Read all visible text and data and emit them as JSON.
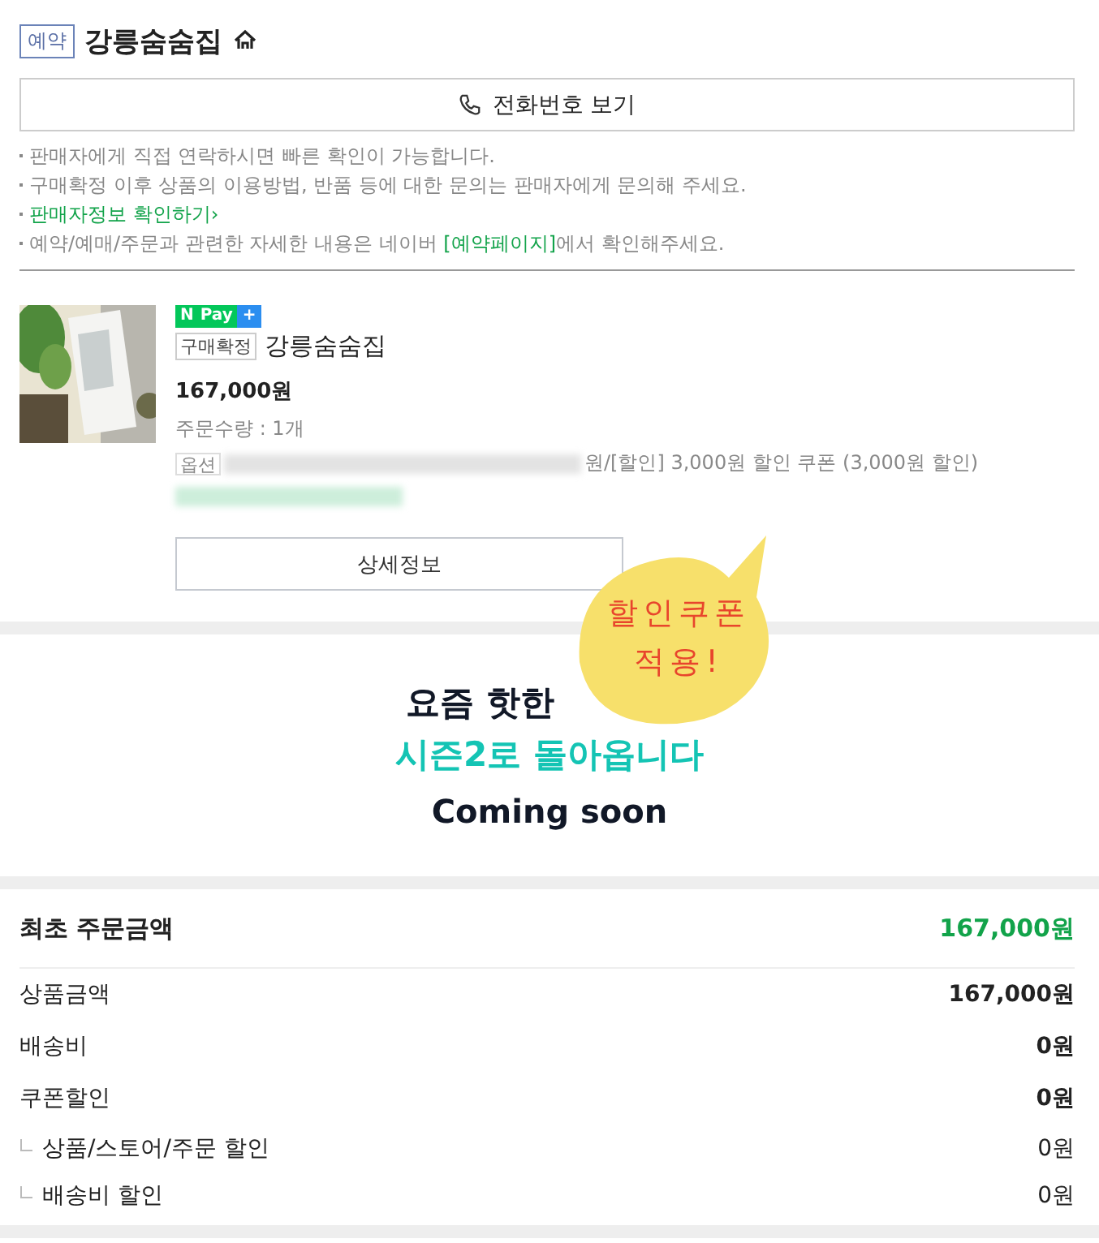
{
  "header": {
    "badge": "예약",
    "store_name": "강릉숨숨집"
  },
  "phone_button": {
    "label": "전화번호 보기"
  },
  "notes": [
    {
      "kind": "plain",
      "text": "판매자에게 직접 연락하시면 빠른 확인이 가능합니다."
    },
    {
      "kind": "plain",
      "text": "구매확정 이후 상품의 이용방법, 반품 등에 대한 문의는 판매자에게 문의해 주세요."
    },
    {
      "kind": "link",
      "text": "판매자정보 확인하기",
      "arrow": "›"
    },
    {
      "kind": "rich",
      "before": "예약/예매/주문과 관련한 자세한 내용은 네이버 ",
      "link": "[예약페이지]",
      "after": "에서 확인해주세요."
    }
  ],
  "product": {
    "pay_badge": {
      "n": "N",
      "pay": "Pay",
      "plus": "+"
    },
    "status": "구매확정",
    "name": "강릉숨숨집",
    "price": "167,000원",
    "quantity": "주문수량 : 1개",
    "option_tag": "옵션",
    "option_text": "원/[할인] 3,000원 할인 쿠폰 (3,000원 할인)",
    "detail_button": "상세정보"
  },
  "sticker": {
    "lines": [
      "할인쿠폰",
      "적용!"
    ]
  },
  "banner": {
    "line1": "요즘 핫한",
    "line2": "시즌2로 돌아옵니다",
    "line3": "Coming soon"
  },
  "summary": {
    "total": {
      "label": "최초 주문금액",
      "value": "167,000원"
    },
    "rows": [
      {
        "kind": "main",
        "label": "상품금액",
        "value": "167,000원"
      },
      {
        "kind": "main",
        "label": "배송비",
        "value": "0원"
      },
      {
        "kind": "main",
        "label": "쿠폰할인",
        "value": "0원"
      },
      {
        "kind": "sub",
        "label": "상품/스토어/주문 할인",
        "value": "0원"
      },
      {
        "kind": "sub",
        "label": "배송비 할인",
        "value": "0원"
      }
    ]
  }
}
